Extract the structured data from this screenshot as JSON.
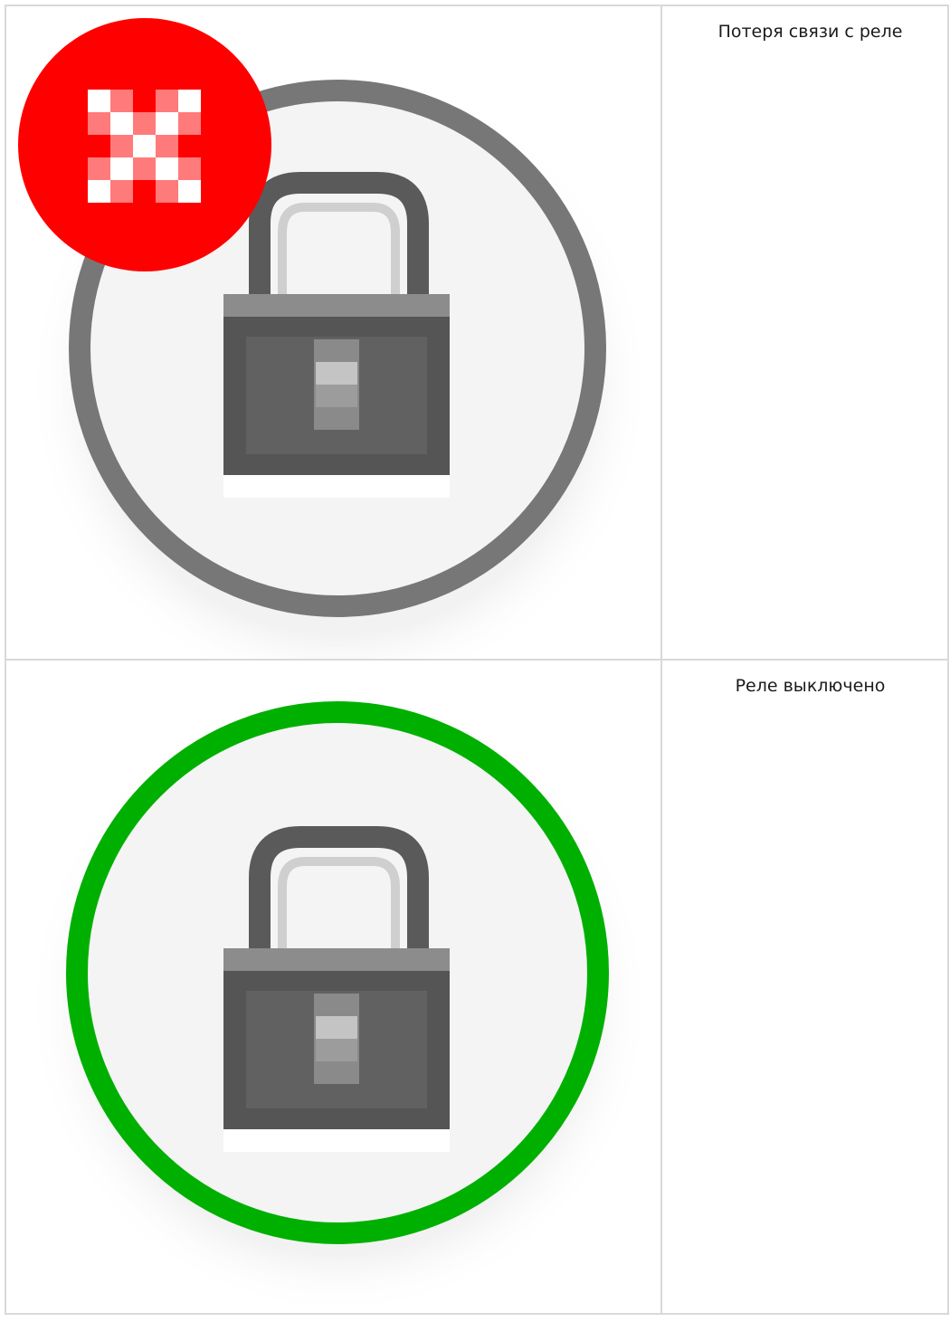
{
  "rows": [
    {
      "label": "Потеря связи с реле",
      "icon": "relay-lock-icon",
      "ring_color": "#777777",
      "badge": "error-x-icon",
      "badge_color": "#ff0000"
    },
    {
      "label": "Реле выключено",
      "icon": "relay-lock-icon",
      "ring_color": "#00b000",
      "badge": null
    }
  ]
}
